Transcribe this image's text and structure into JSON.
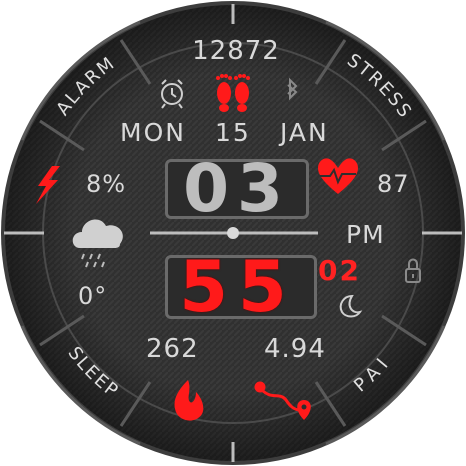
{
  "watch": {
    "steps": "12872",
    "day": "MON",
    "date": "15",
    "month": "JAN",
    "battery": "8%",
    "heart_rate": "87",
    "hour": "03",
    "ampm": "PM",
    "minute": "55",
    "second": "02",
    "temperature": "0°",
    "calories": "262",
    "distance": "4.94"
  },
  "arcs": {
    "alarm": "ALARM",
    "stress": "STRESS",
    "sleep": "SLEEP",
    "pai": "PAI"
  },
  "colors": {
    "accent": "#ff1a1a",
    "text": "#d9d9d9",
    "face": "#2e2e2e",
    "bezel": "#3a3a3a"
  },
  "icons": {
    "alarm": "alarm-clock-icon",
    "steps": "footprints-icon",
    "bluetooth": "bluetooth-icon",
    "battery": "lightning-bolt-icon",
    "heart": "heart-pulse-icon",
    "weather": "cloud-rain-icon",
    "lock": "padlock-icon",
    "moon": "moon-icon",
    "calories": "flame-icon",
    "distance": "route-icon"
  }
}
